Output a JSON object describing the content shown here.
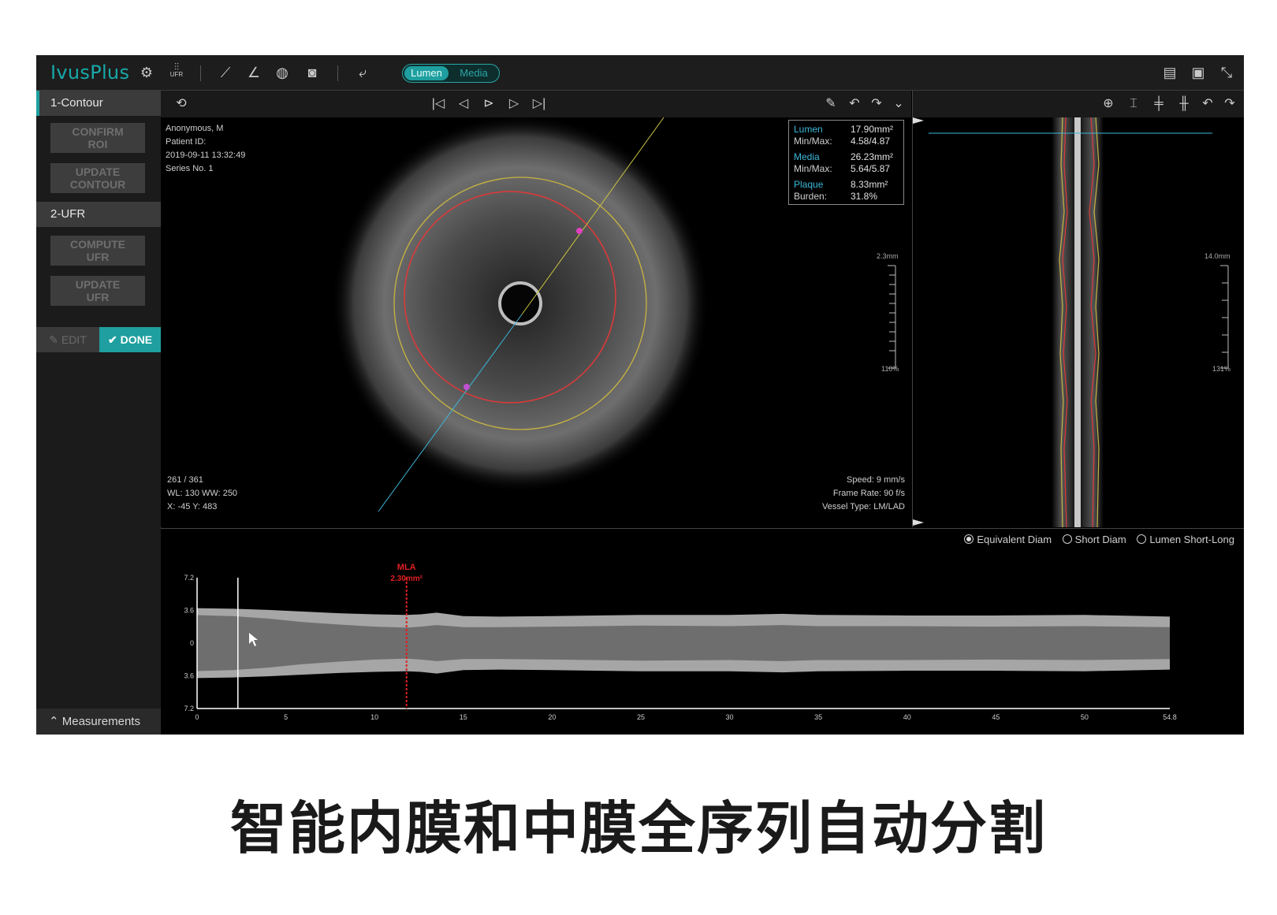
{
  "app": {
    "title": "IvusPlus",
    "accent_color": "#1f9f9f",
    "toggle": {
      "active": "Lumen",
      "inactive": "Media"
    },
    "toolbar_icons": [
      "settings-icon",
      "ufr-sliders-icon",
      "measure-line-icon",
      "angle-icon",
      "texture-icon",
      "camera-icon",
      "export-icon"
    ],
    "toolbar_ufr_label": "UFR",
    "right_icons": [
      "report-icon",
      "save-icon",
      "collapse-icon"
    ]
  },
  "sidebar": {
    "section1": "1-Contour",
    "confirm_roi": "CONFIRM ROI",
    "update_contour": "UPDATE CONTOUR",
    "section2": "2-UFR",
    "compute_ufr": "COMPUTE UFR",
    "update_ufr": "UPDATE UFR",
    "edit": "EDIT",
    "done": "DONE",
    "measurements": "Measurements"
  },
  "patient": {
    "name": "Anonymous, M",
    "id_label": "Patient ID:",
    "datetime": "2019-09-11 13:32:49",
    "series": "Series No. 1"
  },
  "frame": {
    "counter": "261 / 361",
    "wl_ww": "WL: 130  WW: 250",
    "xy": "X: -45  Y: 483"
  },
  "acquisition": {
    "speed": "Speed: 9 mm/s",
    "frame_rate": "Frame Rate: 90 f/s",
    "vessel": "Vessel Type: LM/LAD"
  },
  "measurements": {
    "lumen_label": "Lumen",
    "lumen_area": "17.90mm²",
    "lumen_minmax_label": "Min/Max:",
    "lumen_minmax": "4.58/4.87",
    "media_label": "Media",
    "media_area": "26.23mm²",
    "media_minmax_label": "Min/Max:",
    "media_minmax": "5.64/5.87",
    "plaque_label": "Plaque",
    "plaque_area": "8.33mm²",
    "burden_label": "Burden:",
    "burden": "31.8%"
  },
  "scales": {
    "cross_top": "2.3mm",
    "cross_bottom": "110%",
    "long_top": "14.0mm",
    "long_bottom": "131%"
  },
  "profile": {
    "options": [
      "Equivalent Diam",
      "Short Diam",
      "Lumen Short-Long"
    ],
    "selected": "Equivalent Diam",
    "mla_label": "MLA",
    "mla_value": "2.30mm²",
    "y_ticks": [
      "7.2",
      "3.6",
      "0",
      "3.6",
      "7.2"
    ],
    "x_ticks": [
      "0",
      "5",
      "10",
      "15",
      "20",
      "25",
      "30",
      "35",
      "40",
      "45",
      "50",
      "54.8"
    ]
  },
  "chart_data": {
    "type": "area",
    "x_range": [
      0,
      54.8
    ],
    "ylim": [
      -7.2,
      7.2
    ],
    "mla_x": 11.8,
    "cursor_x": 2.3,
    "x": [
      0,
      2,
      4,
      6,
      8,
      10,
      11.8,
      12.6,
      13.5,
      15,
      17,
      20,
      25,
      30,
      33,
      35,
      40,
      45,
      50,
      54.8
    ],
    "media_diam": [
      6.2,
      6.1,
      5.9,
      5.6,
      5.3,
      5.1,
      5.0,
      5.1,
      5.4,
      4.8,
      4.7,
      4.8,
      5.0,
      5.0,
      5.2,
      5.0,
      4.9,
      4.9,
      5.0,
      4.7
    ],
    "lumen_diam": [
      5.6,
      5.4,
      4.9,
      4.2,
      3.7,
      3.3,
      3.1,
      3.3,
      3.6,
      3.2,
      3.2,
      3.3,
      3.5,
      3.4,
      3.6,
      3.4,
      3.4,
      3.3,
      3.4,
      3.2
    ]
  },
  "caption": "智能内膜和中膜全序列自动分割"
}
